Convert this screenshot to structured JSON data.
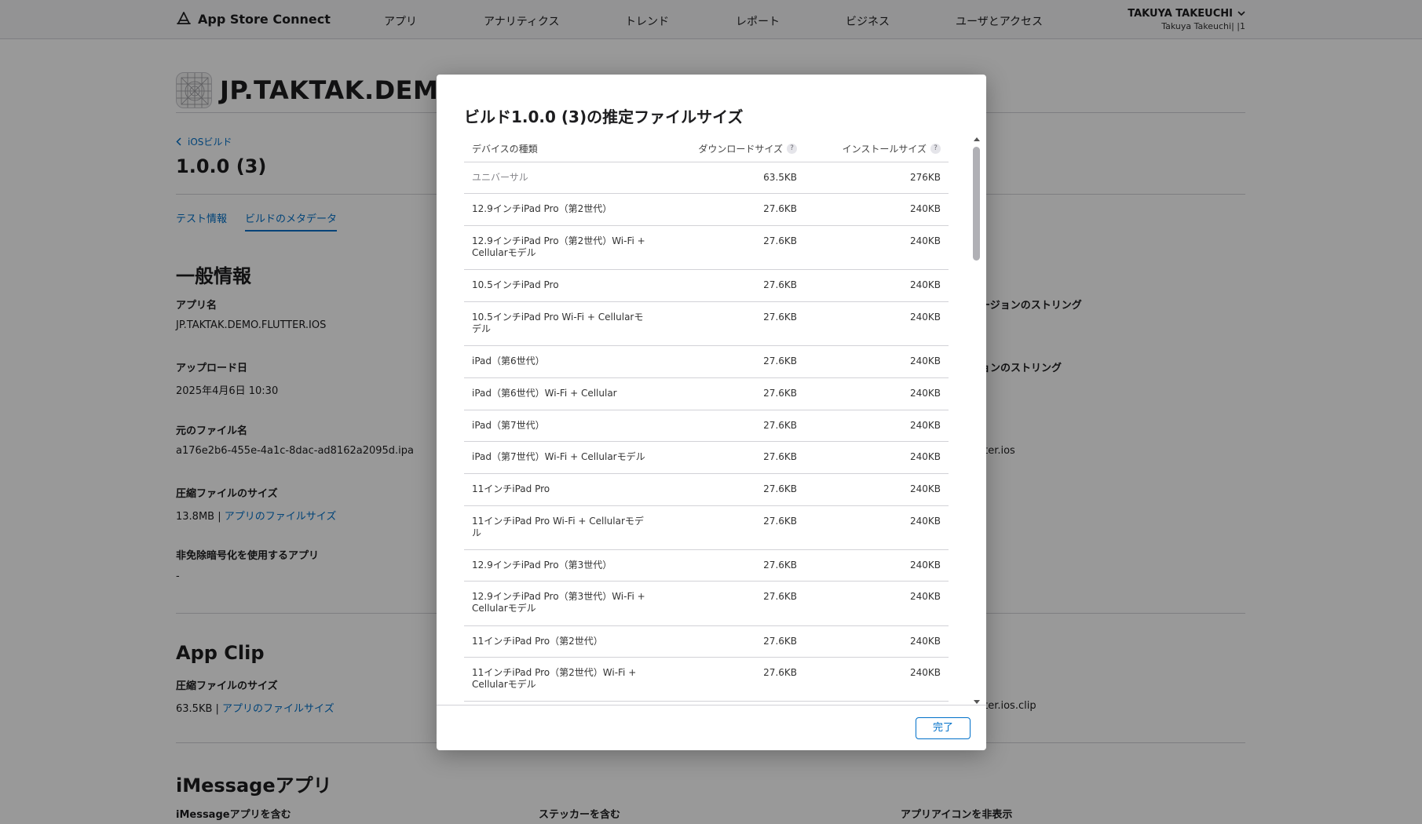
{
  "header": {
    "brand": "App Store Connect",
    "nav": [
      "アプリ",
      "アナリティクス",
      "トレンド",
      "レポート",
      "ビジネス",
      "ユーザとアクセス"
    ],
    "user_name": "TAKUYA TAKEUCHI",
    "user_sub": "Takuya Takeuchi|                |1"
  },
  "page": {
    "app_title": "JP.TAKTAK.DEMO",
    "back_link": "iOSビルド",
    "build_title": "1.0.0 (3)",
    "tabs": [
      "テスト情報",
      "ビルドのメタデータ"
    ],
    "general_title": "一般情報",
    "app_name_label": "アプリ名",
    "app_name_value": "JP.TAKTAK.DEMO.FLUTTER.IOS",
    "upload_label": "アップロード日",
    "upload_value": "2025年4月6日 10:30",
    "filename_label": "元のファイル名",
    "filename_value": "a176e2b6-455e-4a1c-8dac-ad8162a2095d.ipa",
    "compressed_label": "圧縮ファイルのサイズ",
    "compressed_value": "13.8MB | ",
    "filesize_link": "アプリのファイルサイズ",
    "encryption_label": "非免除暗号化を使用するアプリ",
    "encryption_value": "-",
    "right_label_1": "ージョンのストリング",
    "right_label_2": "ョンのストリング",
    "right_value_1": "tter.ios",
    "appclip_title": "App Clip",
    "appclip_label": "圧縮ファイルのサイズ",
    "appclip_value": "63.5KB | ",
    "appclip_link": "アプリのファイルサイズ",
    "appclip_right_value": "tter.ios.clip",
    "imessage_title": "iMessageアプリ",
    "imessage_label_1": "iMessageアプリを含む",
    "imessage_label_2": "ステッカーを含む",
    "imessage_label_3": "アプリアイコンを非表示"
  },
  "modal": {
    "title": "ビルド1.0.0 (3)の推定ファイルサイズ",
    "col_device": "デバイスの種類",
    "col_download": "ダウンロードサイズ",
    "col_install": "インストールサイズ",
    "help": "?",
    "rows": [
      {
        "device": "ユニバーサル",
        "download": "63.5KB",
        "install": "276KB"
      },
      {
        "device": "12.9インチiPad Pro（第2世代）",
        "download": "27.6KB",
        "install": "240KB"
      },
      {
        "device": "12.9インチiPad Pro（第2世代）Wi-Fi + Cellularモデル",
        "download": "27.6KB",
        "install": "240KB"
      },
      {
        "device": "10.5インチiPad Pro",
        "download": "27.6KB",
        "install": "240KB"
      },
      {
        "device": "10.5インチiPad Pro Wi-Fi + Cellularモデル",
        "download": "27.6KB",
        "install": "240KB"
      },
      {
        "device": "iPad（第6世代）",
        "download": "27.6KB",
        "install": "240KB"
      },
      {
        "device": "iPad（第6世代）Wi-Fi + Cellular",
        "download": "27.6KB",
        "install": "240KB"
      },
      {
        "device": "iPad（第7世代）",
        "download": "27.6KB",
        "install": "240KB"
      },
      {
        "device": "iPad（第7世代）Wi-Fi + Cellularモデル",
        "download": "27.6KB",
        "install": "240KB"
      },
      {
        "device": "11インチiPad Pro",
        "download": "27.6KB",
        "install": "240KB"
      },
      {
        "device": "11インチiPad Pro Wi-Fi + Cellularモデル",
        "download": "27.6KB",
        "install": "240KB"
      },
      {
        "device": "12.9インチiPad Pro（第3世代）",
        "download": "27.6KB",
        "install": "240KB"
      },
      {
        "device": "12.9インチiPad Pro（第3世代）Wi-Fi + Cellularモデル",
        "download": "27.6KB",
        "install": "240KB"
      },
      {
        "device": "11インチiPad Pro（第2世代）",
        "download": "27.6KB",
        "install": "240KB"
      },
      {
        "device": "11インチiPad Pro（第2世代）Wi-Fi + Cellularモデル",
        "download": "27.6KB",
        "install": "240KB"
      }
    ],
    "done": "完了"
  }
}
